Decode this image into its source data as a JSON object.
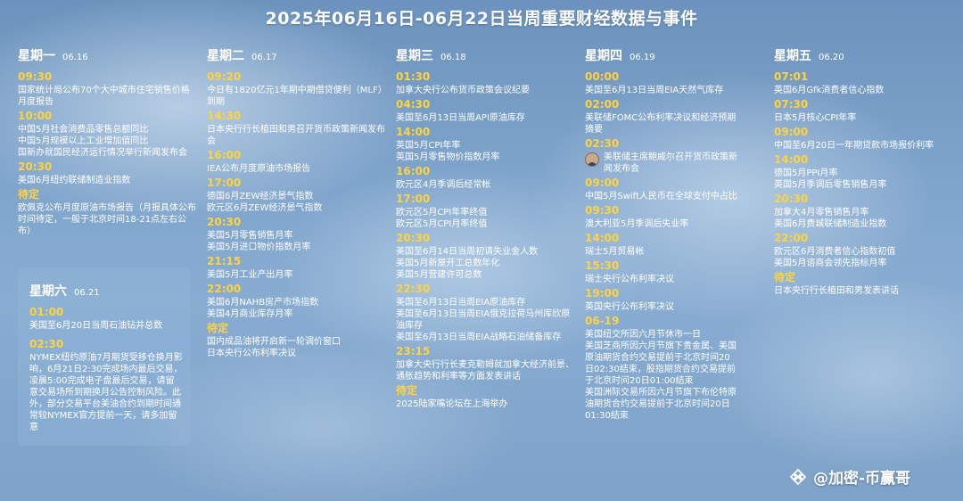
{
  "title": "2025年06月16日-06月22日当周重要财经数据与事件",
  "days": {
    "mon": {
      "name": "星期一",
      "date": "06.16",
      "items": [
        {
          "time": "09:30",
          "events": [
            "国家统计局公布70个大中城市住宅销售价格月度报告"
          ]
        },
        {
          "time": "10:00",
          "events": [
            "中国5月社会消费品零售总额同比",
            "中国5月规模以上工业增加值同比",
            "国新办就国民经济运行情况举行新闻发布会"
          ]
        },
        {
          "time": "20:30",
          "events": [
            "美国6月纽约联储制造业指数"
          ]
        },
        {
          "time": "待定",
          "events": [
            "欧佩克公布月度原油市场报告（月报具体公布时间待定，一般于北京时间18-21点左右公布）"
          ]
        }
      ]
    },
    "tue": {
      "name": "星期二",
      "date": "06.17",
      "items": [
        {
          "time": "09:20",
          "events": [
            "今日有1820亿元1年期中期借贷便利（MLF）到期"
          ]
        },
        {
          "time": "14:30",
          "events": [
            "日本央行行长植田和男召开货币政策新闻发布会"
          ]
        },
        {
          "time": "16:00",
          "events": [
            "IEA公布月度原油市场报告"
          ]
        },
        {
          "time": "17:00",
          "events": [
            "德国6月ZEW经济景气指数",
            "欧元区6月ZEW经济景气指数"
          ]
        },
        {
          "time": "20:30",
          "events": [
            "美国5月零售销售月率",
            "美国5月进口物价指数月率"
          ]
        },
        {
          "time": "21:15",
          "events": [
            "美国5月工业产出月率"
          ]
        },
        {
          "time": "22:00",
          "events": [
            "美国6月NAHB房产市场指数",
            "美国4月商业库存月率"
          ]
        },
        {
          "time": "待定",
          "events": [
            "国内成品油将开启新一轮调价窗口",
            "日本央行公布利率决议"
          ]
        }
      ]
    },
    "wed": {
      "name": "星期三",
      "date": "06.18",
      "items": [
        {
          "time": "01:30",
          "events": [
            "加拿大央行公布货币政策会议纪要"
          ]
        },
        {
          "time": "04:30",
          "events": [
            "美国至6月13日当周API原油库存"
          ]
        },
        {
          "time": "14:00",
          "events": [
            "英国5月CPI年率",
            "英国5月零售物价指数月率"
          ]
        },
        {
          "time": "16:00",
          "events": [
            "欧元区4月季调后经常帐"
          ]
        },
        {
          "time": "17:00",
          "events": [
            "欧元区5月CPI年率终值",
            "欧元区5月CPI月率终值"
          ]
        },
        {
          "time": "20:30",
          "events": [
            "美国至6月14日当周初请失业金人数",
            "美国5月新屋开工总数年化",
            "美国5月营建许可总数"
          ]
        },
        {
          "time": "22:30",
          "events": [
            "美国至6月13日当周EIA原油库存",
            "美国至6月13日当周EIA俄克拉荷马州库欣原油库存",
            "美国至6月13日当周EIA战略石油储备库存"
          ]
        },
        {
          "time": "23:15",
          "events": [
            "加拿大央行行长麦克勒姆就加拿大经济前景、通胀趋势和利率等方面发表讲话"
          ]
        },
        {
          "time": "待定",
          "events": [
            "2025陆家嘴论坛在上海举办"
          ]
        }
      ]
    },
    "thu": {
      "name": "星期四",
      "date": "06.19",
      "items": [
        {
          "time": "00:00",
          "events": [
            "美国至6月13日当周EIA天然气库存"
          ]
        },
        {
          "time": "02:00",
          "events": [
            "美联储FOMC公布利率决议和经济预期摘要"
          ]
        },
        {
          "time": "02:30",
          "events": [
            "美联储主席鲍威尔召开货币政策新闻发布会"
          ],
          "icon": "person-avatar-icon"
        },
        {
          "time": "09:00",
          "events": [
            "中国5月Swift人民币在全球支付中占比"
          ]
        },
        {
          "time": "09:30",
          "events": [
            "澳大利亚5月季调后失业率"
          ]
        },
        {
          "time": "14:00",
          "events": [
            "瑞士5月贸易帐"
          ]
        },
        {
          "time": "15:30",
          "events": [
            "瑞士央行公布利率决议"
          ]
        },
        {
          "time": "19:00",
          "events": [
            "英国央行公布利率决议"
          ]
        },
        {
          "time": "06-19",
          "events": [
            "美国纽交所因六月节休市一日",
            "美国芝商所因六月节旗下贵金属、美国原油期货合约交易提前于北京时间20日02:30结束，股指期货合约交易提前于北京时间20日01:00结束",
            "美国洲际交易所因六月节旗下布伦特原油期货合约交易提前于北京时间20日01:30结束"
          ]
        }
      ]
    },
    "fri": {
      "name": "星期五",
      "date": "06.20",
      "items": [
        {
          "time": "07:01",
          "events": [
            "英国6月Gfk消费者信心指数"
          ]
        },
        {
          "time": "07:30",
          "events": [
            "日本5月核心CPI年率"
          ]
        },
        {
          "time": "09:00",
          "events": [
            "中国至6月20日一年期贷款市场报价利率"
          ]
        },
        {
          "time": "14:00",
          "events": [
            "德国5月PPI月率",
            "英国5月季调后零售销售月率"
          ]
        },
        {
          "time": "20:30",
          "events": [
            "加拿大4月零售销售月率",
            "美国6月费城联储制造业指数"
          ]
        },
        {
          "time": "22:00",
          "events": [
            "欧元区6月消费者信心指数初值",
            "美国5月谘商会领先指标月率"
          ]
        },
        {
          "time": "待定",
          "events": [
            "日本央行行长植田和男发表讲话"
          ]
        }
      ]
    },
    "sat": {
      "name": "星期六",
      "date": "06.21",
      "items": [
        {
          "time": "01:00",
          "events": [
            "美国至6月20日当周石油钻井总数"
          ]
        },
        {
          "time": "02:30",
          "events": [
            "NYMEX纽约原油7月期货受移仓换月影响，6月21日2:30完成场内最后交易，凌晨5:00完成电子盘最后交易，请留意交易场所到期换月公告控制风险。此外，部分交易平台美油合约到期时间通常较NYMEX官方提前一天，请多加留意"
          ]
        }
      ]
    }
  },
  "watermark": {
    "text": "@加密-币赢哥",
    "icon": "binance-diamond-icon"
  },
  "colors": {
    "time": "#ffd33d",
    "text": "#ffffff",
    "background": "#7fa4cb"
  }
}
